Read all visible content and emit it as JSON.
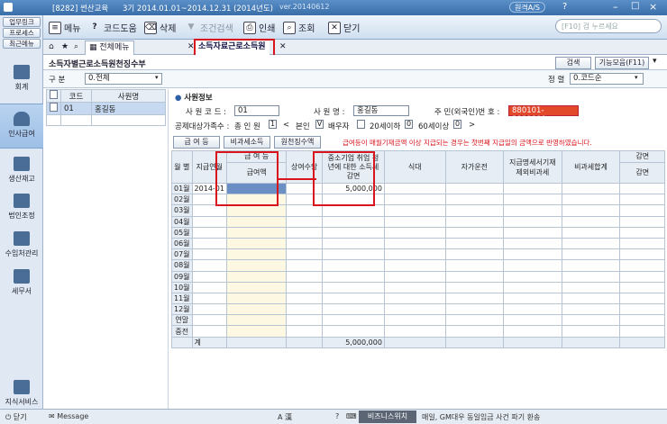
{
  "titlebar": {
    "company": "[8282] 썬산교육",
    "period": "3기 2014.01.01~2014.12.31 (2014년도)",
    "version": "ver.20140612",
    "support": "원격A/S"
  },
  "toolbar": {
    "menu": "메뉴",
    "help": "코드도움",
    "delete": "삭제",
    "condition": "조건검색",
    "print": "인쇄",
    "view": "조회",
    "close": "닫기",
    "search_placeholder": "[F10] 검 누르세요"
  },
  "sidebar": {
    "top_tabs": [
      "업무링크",
      "프로세스",
      "최근메뉴"
    ],
    "items": [
      "회계",
      "인사급여",
      "생산재고",
      "법인조정",
      "수임처관리",
      "세무서"
    ],
    "bottom": [
      "지식서비스",
      "닫기"
    ]
  },
  "tabs": {
    "home": "전체메뉴",
    "active": "소득자료근로소득원"
  },
  "form": {
    "title": "소득자별근로소득원천징수부",
    "btn_search": "검색",
    "btn_func": "기능모음(F11)",
    "filter_label": "구    분",
    "filter_value": "0.전체",
    "sort_label": "정 렬",
    "sort_value": "0.코드순"
  },
  "employee_list": {
    "headers": [
      "코드",
      "사원명"
    ],
    "rows": [
      {
        "code": "01",
        "name": "홍길동"
      }
    ]
  },
  "info": {
    "section": "사원정보",
    "code_label": "사 원 코 드 :",
    "code_value": "01",
    "name_label": "사 원 명 :",
    "name_value": "홍길동",
    "resid_label": "주 민(외국인)번 호 :",
    "resid_value": "880101-2000000",
    "deduct_label": "공제대상가족수 :",
    "dep_label": "총 인 원",
    "dep_value": "1",
    "self_label": "본인",
    "self_value": "V",
    "spouse_label": "배우자",
    "under20_label": "20세이하",
    "under20_value": "0",
    "over60_label": "60세이상",
    "over60_value": "0",
    "btn_pay": "급 여 등",
    "btn_nonpay": "비과세소득",
    "btn_tax": "원천징수액",
    "notice": "급여등이 매월기재금액 이상 지급되는 경우는 첫번째 지급일의 금액으로 반영하였습니다."
  },
  "grid": {
    "col_month": "월 별",
    "col_paydate": "지급연월",
    "col_group": "급 여 등",
    "col_amount": "급여액",
    "col_bonus": "상여수당",
    "col_sme": "중소기업 취업 청년에 대한 소득세 감면",
    "col_meal": "식대",
    "col_car": "자가운전",
    "col_report": "지급명세서기재 제외비과세",
    "col_nontax_total": "비과세합계",
    "col_reduce": "감면",
    "col_reduce2": "감면",
    "months": [
      "01월",
      "02월",
      "03월",
      "04월",
      "05월",
      "06월",
      "07월",
      "08월",
      "09월",
      "10월",
      "11월",
      "12월",
      "연말",
      "중전"
    ],
    "row1_paydate": "2014-01",
    "row1_sme": "5,000,000",
    "total_label": "계",
    "total_sme": "5,000,000"
  },
  "statusbar": {
    "message": "Message",
    "ime": "A 漢",
    "company": "비즈니스위치",
    "ticker": "매일, GM대우 동일임금 사건 파기 환송"
  }
}
